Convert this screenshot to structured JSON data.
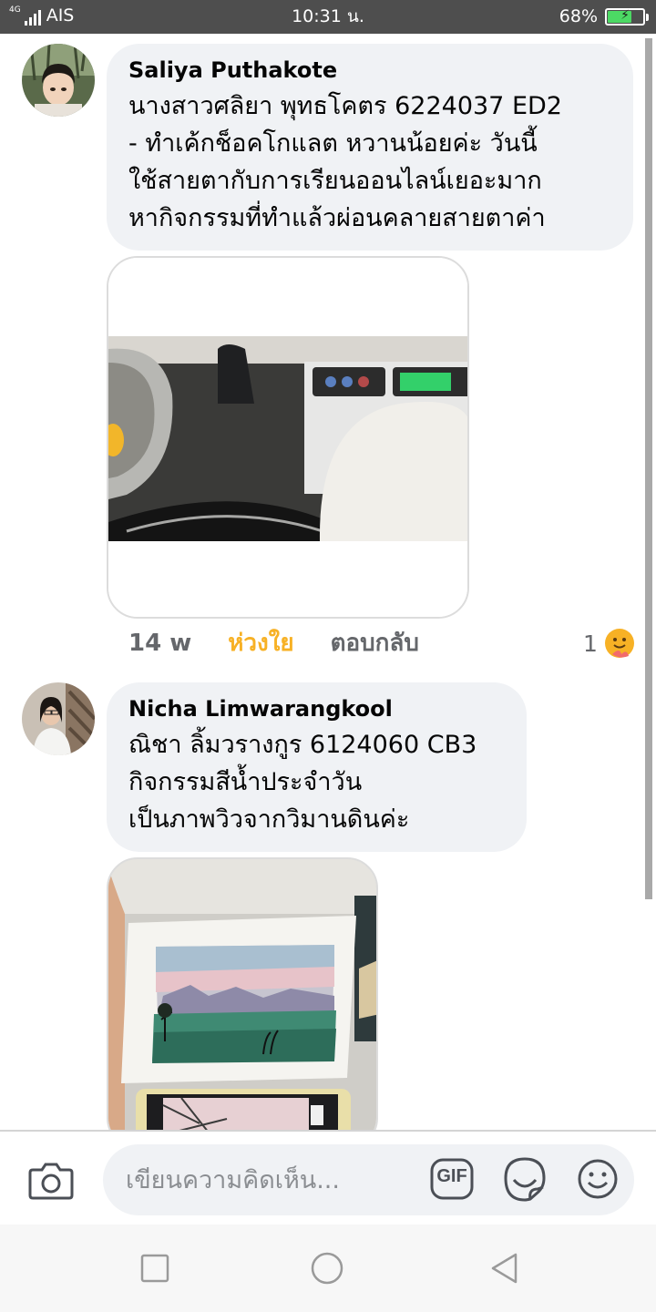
{
  "status_bar": {
    "network": "4G",
    "carrier": "AIS",
    "time": "10:31 น.",
    "battery_percent": "68%",
    "battery_level": 0.68,
    "battery_charging": true
  },
  "comments": [
    {
      "author": "Saliya Puthakote",
      "text": "นางสาวศลิยา พุทธโคตร 6224037 ED2\n- ทำเค้กช็อคโกแลต หวานน้อยค่ะ วันนี้\nใช้สายตากับการเรียนออนไลน์เยอะมาก\nหากิจกรรมที่ทำแล้วผ่อนคลายสายตาค่า",
      "media_icon": "video-thumbnail",
      "time_ago": "14 w",
      "reaction_label": "ห่วงใย",
      "reply_label": "ตอบกลับ",
      "reaction_count": "1",
      "reaction_icon": "care-emoji-icon"
    },
    {
      "author": "Nicha Limwarangkool",
      "text": "ณิชา ลิ้มวรางกูร 6124060 CB3\nกิจกรรมสีน้ำประจำวัน\nเป็นภาพวิวจากวิมานดินค่ะ",
      "media_icon": "watercolor-photo"
    }
  ],
  "composer": {
    "placeholder": "เขียนความคิดเห็น...",
    "gif_label": "GIF",
    "icons": [
      "camera-icon",
      "gif-icon",
      "sticker-icon",
      "emoji-icon"
    ]
  },
  "navigation": {
    "icons": [
      "recent-apps-icon",
      "home-icon",
      "back-icon"
    ]
  },
  "colors": {
    "status_bar": "#4e4e4e",
    "bubble": "#f0f2f5",
    "care_reaction": "#f7b125",
    "secondary_text": "#65676b"
  }
}
